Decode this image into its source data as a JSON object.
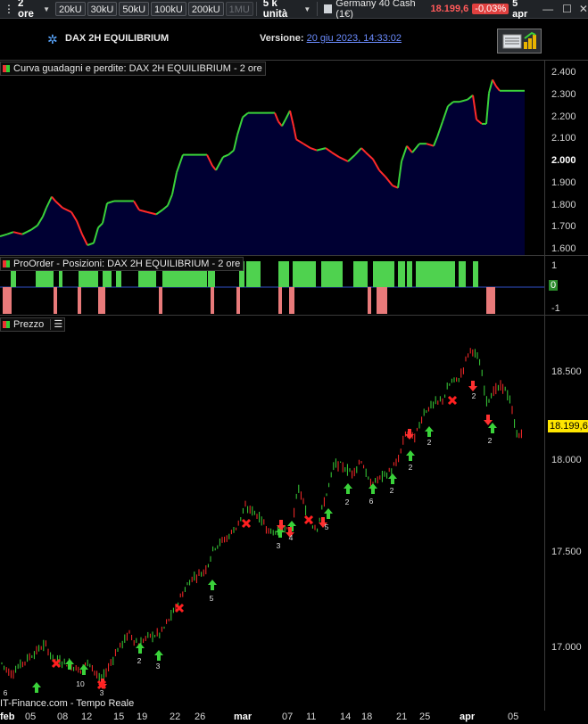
{
  "toolbar": {
    "timeframe": "2 ore",
    "units": [
      "20kU",
      "30kU",
      "50kU",
      "100kU",
      "200kU",
      "1MU"
    ],
    "units_disabled": "1MU",
    "contract_size": "5 k unità",
    "instrument": "Germany 40 Cash (1€)",
    "last_price": "18.199,6",
    "change_pct": "-0,03%",
    "date": "5 apr"
  },
  "header": {
    "strategy_name": "DAX 2H  EQUILIBRIUM",
    "version_label": "Versione:",
    "version_date": "20 giu 2023, 14:33:02"
  },
  "equity_pane": {
    "label": "Curva guadagni e perdite: DAX 2H  EQUILIBRIUM - 2 ore",
    "ticks": [
      "2.400",
      "2.300",
      "2.200",
      "2.100",
      "2.000",
      "1.900",
      "1.800",
      "1.700",
      "1.600"
    ],
    "highlight_tick": "2.000"
  },
  "position_pane": {
    "label": "ProOrder - Posizioni: DAX 2H  EQUILIBRIUM - 2 ore",
    "ticks": [
      "1",
      "0",
      "-1"
    ]
  },
  "price_pane": {
    "label": "Prezzo",
    "ticks": [
      "18.500",
      "18.000",
      "17.500",
      "17.000"
    ],
    "current_price": "18.199,6",
    "trade_labels": [
      "6",
      "10",
      "3",
      "2",
      "3",
      "5",
      "3",
      "4",
      "5",
      "2",
      "6",
      "2",
      "2",
      "2",
      "2",
      "2",
      "4"
    ]
  },
  "footer": {
    "source": "IT-Finance.com - Tempo Reale"
  },
  "xaxis": {
    "labels": [
      "feb",
      "05",
      "08",
      "12",
      "15",
      "19",
      "22",
      "26",
      "mar",
      "07",
      "11",
      "14",
      "18",
      "21",
      "25",
      "apr",
      "05"
    ],
    "bold": [
      "feb",
      "mar",
      "apr"
    ]
  },
  "colors": {
    "up": "#3ad23a",
    "down": "#ff2a2a",
    "equity_fill": "#000033",
    "long": "#4fd24f",
    "short": "#e87a7a",
    "highlight": "#ffe600"
  }
}
